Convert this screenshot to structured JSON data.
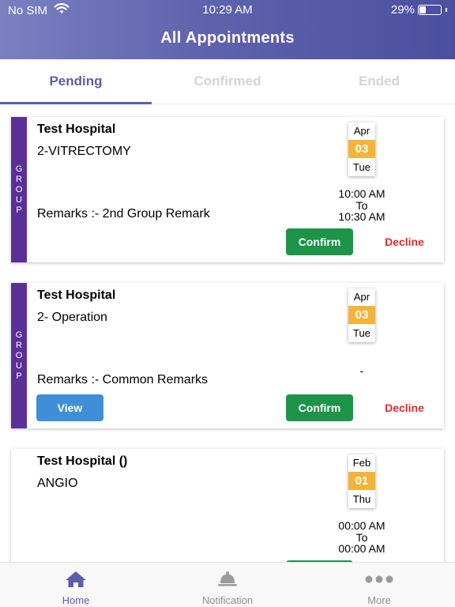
{
  "status_bar": {
    "carrier": "No SIM",
    "time": "10:29 AM",
    "battery_percent": "29%",
    "battery_level": 0.29
  },
  "header": {
    "title": "All Appointments"
  },
  "tabs": [
    {
      "label": "Pending",
      "active": true
    },
    {
      "label": "Confirmed",
      "active": false
    },
    {
      "label": "Ended",
      "active": false
    }
  ],
  "appointments": [
    {
      "group_label": [
        "G",
        "R",
        "O",
        "U",
        "P"
      ],
      "hospital": "Test Hospital",
      "procedure": "2-VITRECTOMY",
      "remarks": "Remarks :- 2nd Group Remark",
      "date": {
        "month": "Apr",
        "day": "03",
        "weekday": "Tue"
      },
      "time_from": "10:00 AM",
      "time_sep": "To",
      "time_to": "10:30 AM",
      "confirm_label": "Confirm",
      "decline_label": "Decline"
    },
    {
      "group_label": [
        "G",
        "R",
        "O",
        "U",
        "P"
      ],
      "hospital": "Test Hospital",
      "procedure": "2- Operation",
      "remarks": "Remarks :- Common Remarks",
      "date": {
        "month": "Apr",
        "day": "03",
        "weekday": "Tue"
      },
      "time_placeholder": "-",
      "view_label": "View",
      "confirm_label": "Confirm",
      "decline_label": "Decline"
    },
    {
      "hospital": "Test Hospital ()",
      "procedure": "ANGIO",
      "date": {
        "month": "Feb",
        "day": "01",
        "weekday": "Thu"
      },
      "time_from": "00:00 AM",
      "time_sep": "To",
      "time_to": "00:00 AM"
    }
  ],
  "bottom_nav": [
    {
      "label": "Home",
      "icon": "home-icon",
      "active": true
    },
    {
      "label": "Notification",
      "icon": "bell-icon",
      "active": false
    },
    {
      "label": "More",
      "icon": "more-icon",
      "active": false
    }
  ],
  "colors": {
    "primary": "#5a5fa8",
    "group_strip": "#5b2f98",
    "date_highlight": "#f4b43a",
    "confirm": "#1e9448",
    "decline": "#e02d2d",
    "view": "#3f8fd8"
  }
}
